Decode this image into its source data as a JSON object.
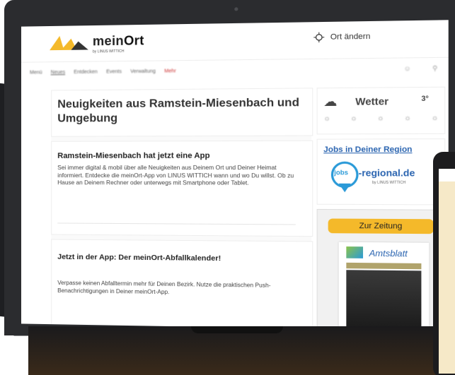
{
  "header": {
    "brand_prefix": "mein",
    "brand_suffix": "Ort",
    "brand_sub": "by LINUS WITTICH",
    "location_label": "Ort ändern"
  },
  "nav": {
    "items": [
      "Menü",
      "Neues",
      "Entdecken",
      "Events",
      "Verwaltung",
      "Mehr"
    ]
  },
  "main": {
    "headline": "Neuigkeiten aus Ramstein-Miesenbach und Umgebung",
    "article1": {
      "title": "Ramstein-Miesenbach hat jetzt eine App",
      "body": "Sei immer digital & mobil über alle Neuigkeiten aus Deinem Ort und Deiner Heimat informiert. Entdecke die meinOrt-App von LINUS WITTICH wann und wo Du willst. Ob zu Hause an Deinem Rechner oder unterwegs mit Smartphone oder Tablet."
    },
    "article2": {
      "title": "Jetzt in der App: Der meinOrt-Abfallkalender!",
      "body": "Verpasse keinen Abfalltermin mehr für Deinen Bezirk. Nutze die praktischen Push-Benachrichtigungen in Deiner meinOrt-App."
    }
  },
  "sidebar": {
    "weather_label": "Wetter",
    "temperature": "3°",
    "jobs_title": "Jobs in Deiner Region",
    "jobs_brand_prefix": "jobs",
    "jobs_brand_suffix": "-regional.de",
    "jobs_sub": "by LINUS WITTICH",
    "zeitung_button": "Zur Zeitung",
    "newspaper_title": "Amtsblatt"
  },
  "colors": {
    "accent_yellow": "#f4b92a",
    "link_blue": "#2a64b0",
    "jobs_blue": "#2a9ad8"
  }
}
